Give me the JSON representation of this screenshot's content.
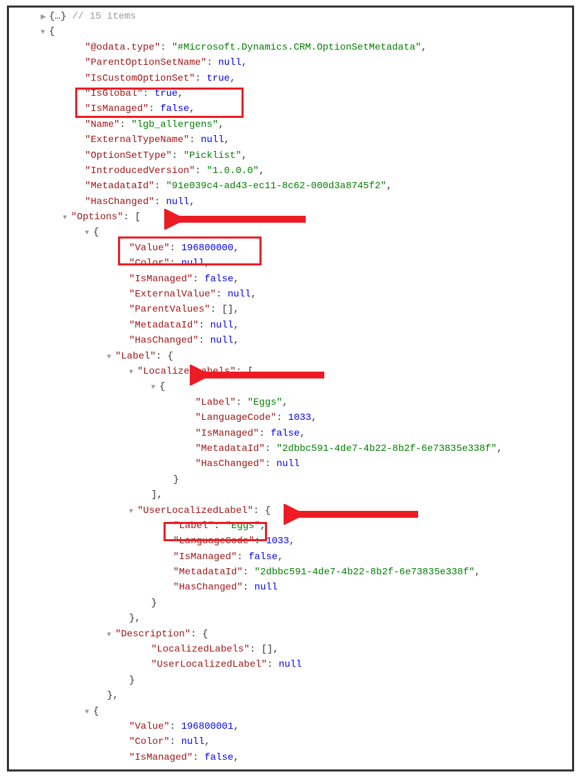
{
  "json": {
    "top_items_comment": "// 15 items",
    "odata_type_key": "\"@odata.type\"",
    "odata_type_val": "\"#Microsoft.Dynamics.CRM.OptionSetMetadata\"",
    "parent_key": "\"ParentOptionSetName\"",
    "iscustom_key": "\"IsCustomOptionSet\"",
    "isglobal_key": "\"IsGlobal\"",
    "ismanaged_key": "\"IsManaged\"",
    "name_key": "\"Name\"",
    "name_val": "\"lgb_allergens\"",
    "ext_type_key": "\"ExternalTypeName\"",
    "opt_set_type_key": "\"OptionSetType\"",
    "opt_set_type_val": "\"Picklist\"",
    "intro_ver_key": "\"IntroducedVersion\"",
    "intro_ver_val": "\"1.0.0.0\"",
    "metadata_id_key": "\"MetadataId\"",
    "metadata_id_val": "\"91e039c4-ad43-ec11-8c62-000d3a8745f2\"",
    "haschanged_key": "\"HasChanged\"",
    "options_key": "\"Options\"",
    "value_key": "\"Value\"",
    "value_val": "196800000",
    "color_key": "\"Color\"",
    "extval_key": "\"ExternalValue\"",
    "parentvals_key": "\"ParentValues\"",
    "label_key": "\"Label\"",
    "loclabels_key": "\"LocalizedLabels\"",
    "label_inner_key": "\"Label\"",
    "label_inner_val": "\"Eggs\"",
    "langcode_key": "\"LanguageCode\"",
    "langcode_val": "1033",
    "metaid2_val": "\"2dbbc591-4de7-4b22-8b2f-6e73835e338f\"",
    "userloc_key": "\"UserLocalizedLabel\"",
    "desc_key": "\"Description\"",
    "value2_val": "196800001",
    "null_txt": "null",
    "true_txt": "true",
    "false_txt": "false"
  }
}
